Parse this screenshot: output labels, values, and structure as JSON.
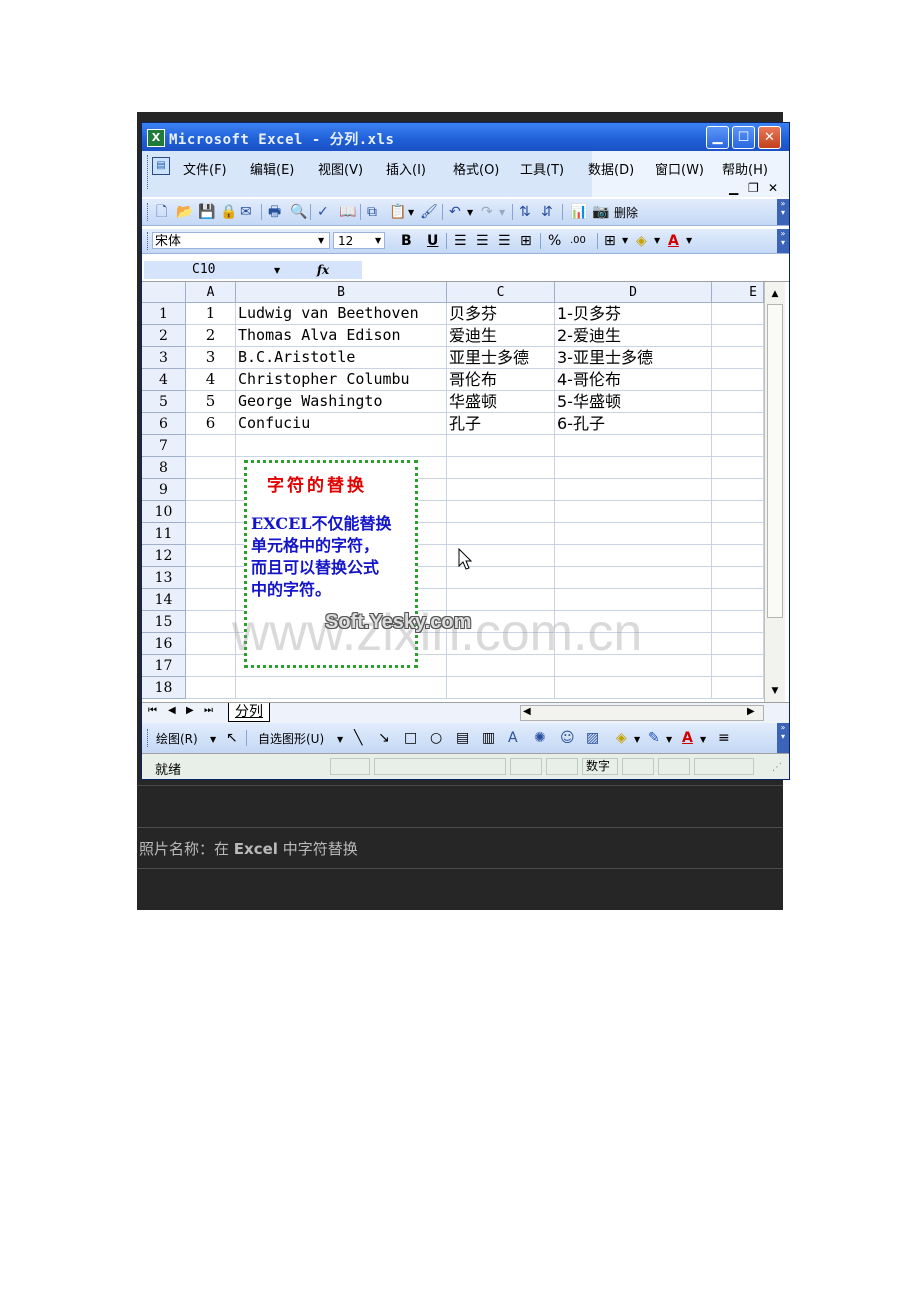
{
  "window": {
    "title": "Microsoft Excel - 分列.xls",
    "app_icon": "excel-icon",
    "controls": [
      "minimize",
      "maximize",
      "close"
    ]
  },
  "menu": {
    "items": [
      "文件(F)",
      "编辑(E)",
      "视图(V)",
      "插入(I)",
      "格式(O)",
      "工具(T)",
      "数据(D)",
      "窗口(W)",
      "帮助(H)"
    ],
    "mdi_restore": "▁ ❐ ✕"
  },
  "toolbar": {
    "delete_label": "删除"
  },
  "format": {
    "font": "宋体",
    "size": "12",
    "bold": "B",
    "underline": "U",
    "percent": "%",
    "decimals": ".00",
    "font_color": "A"
  },
  "formula_bar": {
    "name_box": "C10",
    "fx": "fx"
  },
  "grid": {
    "columns": [
      "A",
      "B",
      "C",
      "D",
      "E"
    ],
    "row_numbers": [
      "1",
      "2",
      "3",
      "4",
      "5",
      "6",
      "7",
      "8",
      "9",
      "10",
      "11",
      "12",
      "13",
      "14",
      "15",
      "16",
      "17",
      "18"
    ],
    "rows": [
      [
        "1",
        "Ludwig van Beethoven",
        "贝多芬",
        "1-贝多芬"
      ],
      [
        "2",
        "Thomas Alva Edison",
        "爱迪生",
        "2-爱迪生"
      ],
      [
        "3",
        "B.C.Aristotle",
        "亚里士多德",
        "3-亚里士多德"
      ],
      [
        "4",
        "Christopher Columbu",
        "哥伦布",
        "4-哥伦布"
      ],
      [
        "5",
        "George Washingto",
        "华盛顿",
        "5-华盛顿"
      ],
      [
        "6",
        "Confuciu",
        "孔子",
        "6-孔子"
      ]
    ]
  },
  "textbox": {
    "title": "字符的替换",
    "body_lines": [
      "EXCEL不仅能替换",
      "单元格中的字符，",
      "而且可以替换公式",
      "中的字符。"
    ]
  },
  "watermark": {
    "logo": "Soft.Yesky.com",
    "url": "www.zixin.com.cn"
  },
  "sheet_tabs": [
    "分列"
  ],
  "drawing_toolbar": {
    "draw_label": "绘图(R)",
    "autoshapes_label": "自选图形(U)"
  },
  "status": {
    "ready": "就绪",
    "num": "数字"
  },
  "caption": {
    "prefix": "照片名称：在 ",
    "bold": "Excel",
    "suffix": " 中字符替换"
  },
  "colors": {
    "titlebar": "#1f5fd6",
    "textbox_border": "#2aa02a",
    "textbox_title": "#e00000",
    "textbox_body": "#1414c8",
    "frame": "#262626"
  }
}
